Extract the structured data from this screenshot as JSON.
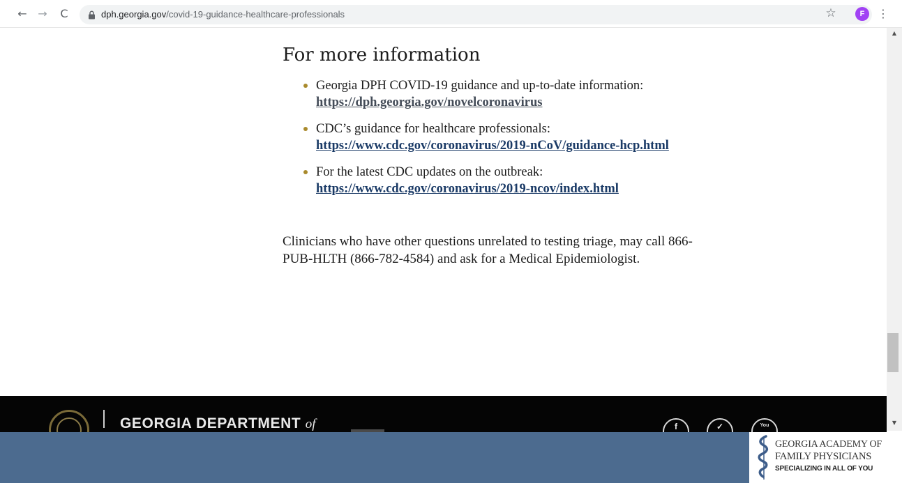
{
  "browser": {
    "url_domain": "dph.georgia.gov",
    "url_path": "/covid-19-guidance-healthcare-professionals",
    "back_glyph": "←",
    "forward_glyph": "→",
    "reload_glyph": "C",
    "star_glyph": "☆",
    "avatar_initial": "F",
    "menu_glyph": "⋮",
    "avatar_color": "#a142f4"
  },
  "section": {
    "heading": "For more information",
    "items": [
      {
        "text": "Georgia DPH COVID-19 guidance and up-to-date information: ",
        "link": "https://dph.georgia.gov/novelcoronavirus"
      },
      {
        "text": "CDC’s guidance for healthcare professionals: ",
        "link": "https://www.cdc.gov/coronavirus/2019-nCoV/guidance-hcp.html"
      },
      {
        "text": "For the latest CDC updates on the outbreak: ",
        "link": "https://www.cdc.gov/coronavirus/2019-ncov/index.html"
      }
    ],
    "paragraph": "Clinicians who have other questions unrelated to testing triage, may call 866-PUB-HLTH (866-782-4584) and ask for a Medical Epidemiologist."
  },
  "scrollbar": {
    "up_glyph": "▲",
    "down_glyph": "▼"
  },
  "footer": {
    "title_main": "GEORGIA DEPARTMENT ",
    "title_of": "of",
    "social_facebook": "f",
    "social_twitter": "✓",
    "social_youtube": "You"
  },
  "banner": {
    "org_line1": "GEORGIA ACADEMY OF",
    "org_line2": "FAMILY PHYSICIANS",
    "org_tagline": "SPECIALIZING IN ALL OF YOU",
    "banner_color": "#4c6b8f",
    "icon": "caduceus-logo-icon"
  }
}
